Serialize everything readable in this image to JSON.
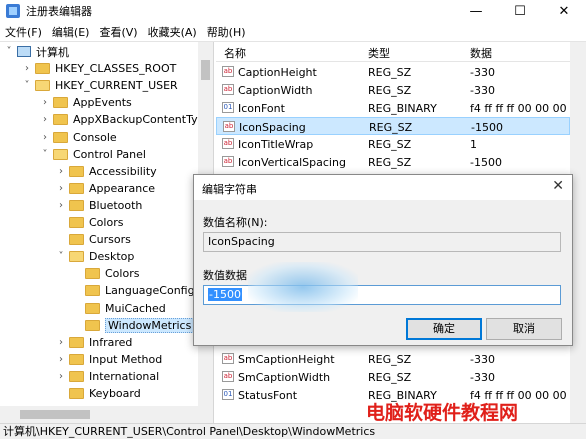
{
  "window": {
    "title": "注册表编辑器",
    "minimize": "—",
    "maximize": "☐",
    "close": "✕"
  },
  "menu": [
    "文件(F)",
    "编辑(E)",
    "查看(V)",
    "收藏夹(A)",
    "帮助(H)"
  ],
  "tree": [
    {
      "label": "计算机",
      "expand": "˅",
      "level": 0,
      "icon": "computer-icon"
    },
    {
      "label": "HKEY_CLASSES_ROOT",
      "expand": "›",
      "level": 1
    },
    {
      "label": "HKEY_CURRENT_USER",
      "expand": "˅",
      "level": 1
    },
    {
      "label": "AppEvents",
      "expand": "›",
      "level": 2
    },
    {
      "label": "AppXBackupContentType",
      "expand": "›",
      "level": 2
    },
    {
      "label": "Console",
      "expand": "›",
      "level": 2
    },
    {
      "label": "Control Panel",
      "expand": "˅",
      "level": 2
    },
    {
      "label": "Accessibility",
      "expand": "›",
      "level": 3
    },
    {
      "label": "Appearance",
      "expand": "›",
      "level": 3
    },
    {
      "label": "Bluetooth",
      "expand": "›",
      "level": 3
    },
    {
      "label": "Colors",
      "expand": "",
      "level": 3
    },
    {
      "label": "Cursors",
      "expand": "",
      "level": 3
    },
    {
      "label": "Desktop",
      "expand": "˅",
      "level": 3
    },
    {
      "label": "Colors",
      "expand": "",
      "level": 4
    },
    {
      "label": "LanguageConfigu",
      "expand": "",
      "level": 4
    },
    {
      "label": "MuiCached",
      "expand": "",
      "level": 4
    },
    {
      "label": "WindowMetrics",
      "expand": "",
      "level": 4,
      "selected": true
    },
    {
      "label": "Infrared",
      "expand": "›",
      "level": 3
    },
    {
      "label": "Input Method",
      "expand": "›",
      "level": 3
    },
    {
      "label": "International",
      "expand": "›",
      "level": 3
    },
    {
      "label": "Keyboard",
      "expand": "",
      "level": 3
    }
  ],
  "list": {
    "headers": {
      "name": "名称",
      "type": "类型",
      "data": "数据"
    },
    "rows": [
      {
        "name": "CaptionHeight",
        "type": "REG_SZ",
        "data": "-330",
        "icon": "ab"
      },
      {
        "name": "CaptionWidth",
        "type": "REG_SZ",
        "data": "-330",
        "icon": "ab"
      },
      {
        "name": "IconFont",
        "type": "REG_BINARY",
        "data": "f4 ff ff ff 00 00 00 00",
        "icon": "bin"
      },
      {
        "name": "IconSpacing",
        "type": "REG_SZ",
        "data": "-1500",
        "icon": "ab",
        "selected": true
      },
      {
        "name": "IconTitleWrap",
        "type": "REG_SZ",
        "data": "1",
        "icon": "ab"
      },
      {
        "name": "IconVerticalSpacing",
        "type": "REG_SZ",
        "data": "-1500",
        "icon": "ab"
      }
    ],
    "rows_bottom": [
      {
        "name": "SmCaptionHeight",
        "type": "REG_SZ",
        "data": "-330",
        "icon": "ab"
      },
      {
        "name": "SmCaptionWidth",
        "type": "REG_SZ",
        "data": "-330",
        "icon": "ab"
      },
      {
        "name": "StatusFont",
        "type": "REG_BINARY",
        "data": "f4 ff ff ff 00 00 00 00",
        "icon": "bin"
      }
    ]
  },
  "dialog": {
    "title": "编辑字符串",
    "close": "✕",
    "name_label": "数值名称(N):",
    "name_value": "IconSpacing",
    "data_label": "数值数据",
    "data_value": "-1500",
    "ok": "确定",
    "cancel": "取消"
  },
  "statusbar": "计算机\\HKEY_CURRENT_USER\\Control Panel\\Desktop\\WindowMetrics",
  "watermark": "电脑软硬件教程网"
}
